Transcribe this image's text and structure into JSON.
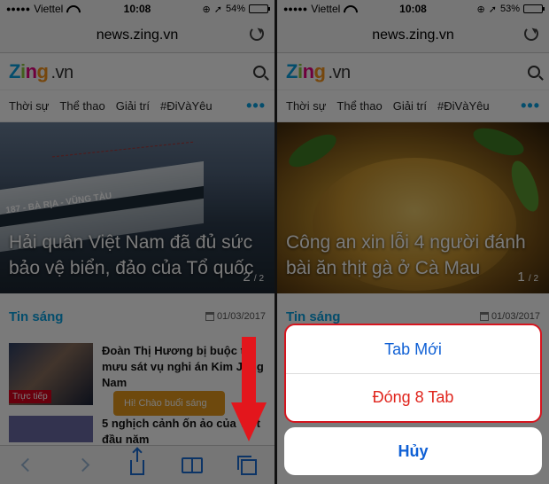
{
  "left": {
    "status": {
      "carrier": "Viettel",
      "time": "10:08",
      "battery": "54%",
      "battery_level": 0.54
    },
    "url": "news.zing.vn",
    "site": {
      "logo_word": "Zing",
      "logo_suffix": ".vn"
    },
    "nav": [
      "Thời sự",
      "Thể thao",
      "Giải trí",
      "#ĐiVàYêu"
    ],
    "nav_more": "•••",
    "hero": {
      "title": "Hải quân Việt Nam đã đủ sức bảo vệ biển, đảo của Tổ quốc",
      "page": "2",
      "total": "2",
      "ship_label": "187 - BÀ RỊA - VŨNG TÀU"
    },
    "section": {
      "title": "Tin sáng",
      "date": "01/03/2017"
    },
    "articles": [
      {
        "title": "Đoàn Thị Hương bị buộc tội mưu sát vụ nghi án Kim Jong Nam",
        "badge": "Trực tiếp"
      },
      {
        "title": "5 nghịch cảnh ốn ảo của Việt đầu năm"
      }
    ],
    "chat": "Hi! Chào buổi sáng"
  },
  "right": {
    "status": {
      "carrier": "Viettel",
      "time": "10:08",
      "battery": "53%",
      "battery_level": 0.53
    },
    "url": "news.zing.vn",
    "site": {
      "logo_word": "Zing",
      "logo_suffix": ".vn"
    },
    "nav": [
      "Thời sự",
      "Thể thao",
      "Giải trí",
      "#ĐiVàYêu"
    ],
    "nav_more": "•••",
    "hero": {
      "title": "Công an xin lỗi 4 người đánh bài ăn thịt gà ở Cà Mau",
      "page": "1",
      "total": "2"
    },
    "section": {
      "title": "Tin sáng",
      "date": "01/03/2017"
    },
    "sheet": {
      "new_tab": "Tab Mới",
      "close_tabs": "Đóng 8 Tab",
      "cancel": "Hủy"
    }
  },
  "colors": {
    "accent": "#0aa1e2",
    "ios_blue": "#0f60d5",
    "destructive": "#e0241c",
    "highlight_red": "#d6161f",
    "live_red": "#d9001d",
    "chat_orange": "#e69a1d"
  },
  "icons": [
    "wifi-icon",
    "location-icon",
    "alarm-icon",
    "battery-icon",
    "reload-icon",
    "search-icon",
    "calendar-icon",
    "back-icon",
    "forward-icon",
    "share-icon",
    "bookmarks-icon",
    "tabs-icon",
    "down-arrow-icon"
  ]
}
